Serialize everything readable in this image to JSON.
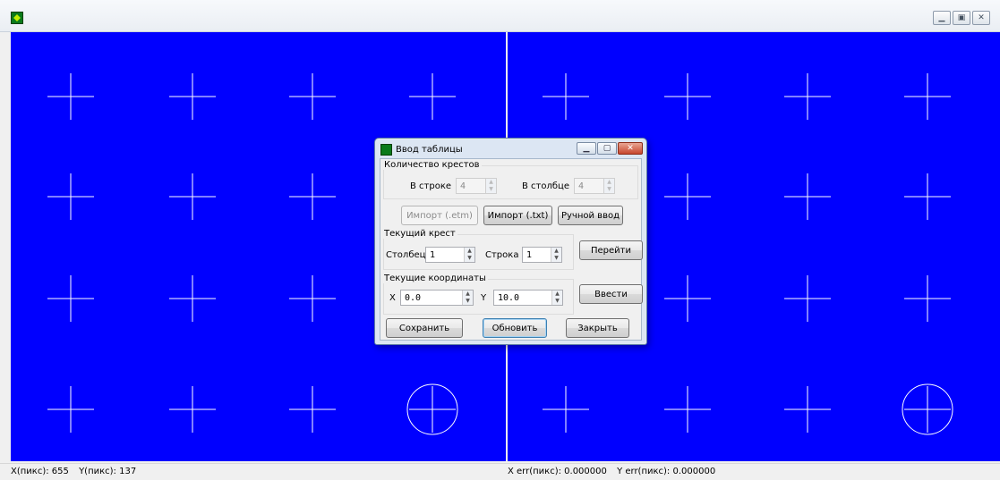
{
  "window": {
    "title_icon": "app-icon",
    "buttons": [
      "minimize-icon",
      "restore-icon",
      "close-icon"
    ]
  },
  "canvas": {
    "background_color": "#0000ff",
    "crosshair_color": "#ffffff",
    "rows": 4,
    "cols": 4,
    "circled_cell": {
      "row": 4,
      "col": 4
    }
  },
  "status": {
    "x_pix": "X(пикс): 655",
    "y_pix": "Y(пикс): 137",
    "x_err": "X err(пикс): 0.000000",
    "y_err": "Y err(пикс): 0.000000"
  },
  "dialog": {
    "title": "Ввод таблицы",
    "group_count": {
      "label": "Количество крестов",
      "row_label": "В строке",
      "row_value": "4",
      "col_label": "В столбце",
      "col_value": "4"
    },
    "import_etm": "Импорт (.etm)",
    "import_txt": "Импорт (.txt)",
    "manual": "Ручной ввод",
    "group_current": {
      "label": "Текущий крест",
      "col_label": "Столбец",
      "col_value": "1",
      "row_label": "Строка",
      "row_value": "1"
    },
    "goto": "Перейти",
    "group_coords": {
      "label": "Текущие координаты",
      "x_label": "X",
      "x_value": "0.0",
      "y_label": "Y",
      "y_value": "10.0"
    },
    "enter": "Ввести",
    "save": "Сохранить",
    "refresh": "Обновить",
    "close": "Закрыть"
  }
}
